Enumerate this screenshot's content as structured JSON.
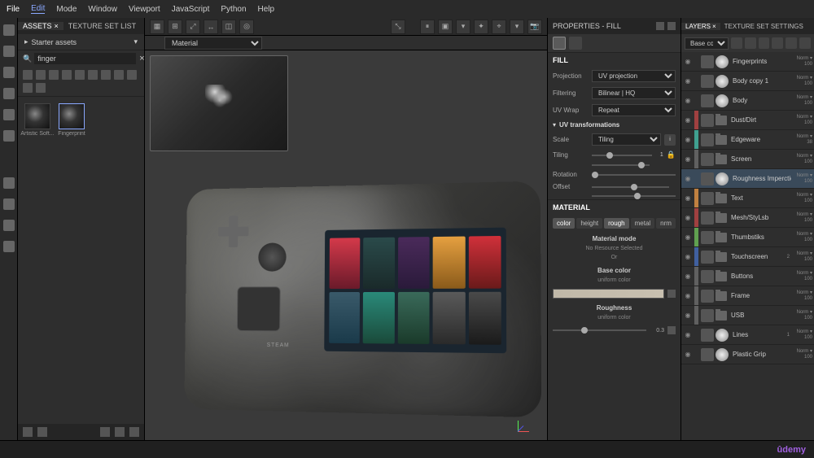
{
  "menu": [
    "File",
    "Edit",
    "Mode",
    "Window",
    "Viewport",
    "JavaScript",
    "Python",
    "Help"
  ],
  "assets": {
    "tab1": "ASSETS",
    "tab2": "TEXTURE SET LIST",
    "folder": "Starter assets",
    "search": "finger",
    "thumbs": [
      {
        "label": "Artistic Soft..."
      },
      {
        "label": "Fingerprint"
      }
    ]
  },
  "viewport": {
    "subbar_mode": "Material",
    "device_logo": "STEAM"
  },
  "props": {
    "title": "PROPERTIES - FILL",
    "fill_h": "FILL",
    "projection_l": "Projection",
    "projection_v": "UV projection",
    "filtering_l": "Filtering",
    "filtering_v": "Bilinear | HQ",
    "uvwrap_l": "UV Wrap",
    "uvwrap_v": "Repeat",
    "uvtrans": "UV transformations",
    "scale_l": "Scale",
    "scale_v": "Tiling",
    "tiling_l": "Tiling",
    "tiling_v": "1",
    "rotation_l": "Rotation",
    "offset_l": "Offset",
    "material_h": "MATERIAL",
    "channels": [
      "color",
      "height",
      "rough",
      "metal",
      "nrm"
    ],
    "mat_mode": "Material mode",
    "mat_mode_sub": "No Resource Selected",
    "or": "Or",
    "basecolor": "Base color",
    "basecolor_sub": "uniform color",
    "roughness": "Roughness",
    "roughness_sub": "uniform color",
    "rough_val": "0.3"
  },
  "layers": {
    "tab1": "LAYERS",
    "tab2": "TEXTURE SET SETTINGS",
    "blend_select": "Base color",
    "list": [
      {
        "name": "Fingerprints",
        "color": "cb-none",
        "type": "fill",
        "blend1": "Norm",
        "blend2": "100"
      },
      {
        "name": "Body copy 1",
        "color": "cb-none",
        "type": "fill",
        "blend1": "Norm",
        "blend2": "100"
      },
      {
        "name": "Body",
        "color": "cb-none",
        "type": "fill",
        "blend1": "Norm",
        "blend2": "100"
      },
      {
        "name": "Dust/Dirt",
        "color": "cb-red",
        "type": "folder",
        "blend1": "Norm",
        "blend2": "100"
      },
      {
        "name": "Edgeware",
        "color": "cb-teal",
        "type": "folder",
        "blend1": "Norm",
        "blend2": "38"
      },
      {
        "name": "Screen",
        "color": "cb-gray",
        "type": "folder",
        "blend1": "Norm",
        "blend2": "100"
      },
      {
        "name": "Roughness Imperction",
        "color": "cb-none",
        "type": "fill",
        "blend1": "Norm",
        "blend2": "100",
        "sel": true
      },
      {
        "name": "Text",
        "color": "cb-orange",
        "type": "folder",
        "blend1": "Norm",
        "blend2": "100"
      },
      {
        "name": "Mesh/StyLsb",
        "color": "cb-red",
        "type": "folder",
        "blend1": "Norm",
        "blend2": "100"
      },
      {
        "name": "Thumbstiks",
        "color": "cb-green",
        "type": "folder",
        "blend1": "Norm",
        "blend2": "100"
      },
      {
        "name": "Touchscreen",
        "color": "cb-blue",
        "type": "folder",
        "blend1": "Norm",
        "blend2": "100",
        "extra": "2"
      },
      {
        "name": "Buttons",
        "color": "cb-gray",
        "type": "folder",
        "blend1": "Norm",
        "blend2": "100"
      },
      {
        "name": "Frame",
        "color": "cb-gray",
        "type": "folder",
        "blend1": "Norm",
        "blend2": "100"
      },
      {
        "name": "USB",
        "color": "cb-gray",
        "type": "folder",
        "blend1": "Norm",
        "blend2": "100"
      },
      {
        "name": "Lines",
        "color": "cb-none",
        "type": "fill",
        "blend1": "Norm",
        "blend2": "100",
        "extra": "1"
      },
      {
        "name": "Plastic Grip",
        "color": "cb-none",
        "type": "fill",
        "blend1": "Norm",
        "blend2": "100"
      }
    ]
  },
  "status": {
    "brand": "ûdemy"
  }
}
